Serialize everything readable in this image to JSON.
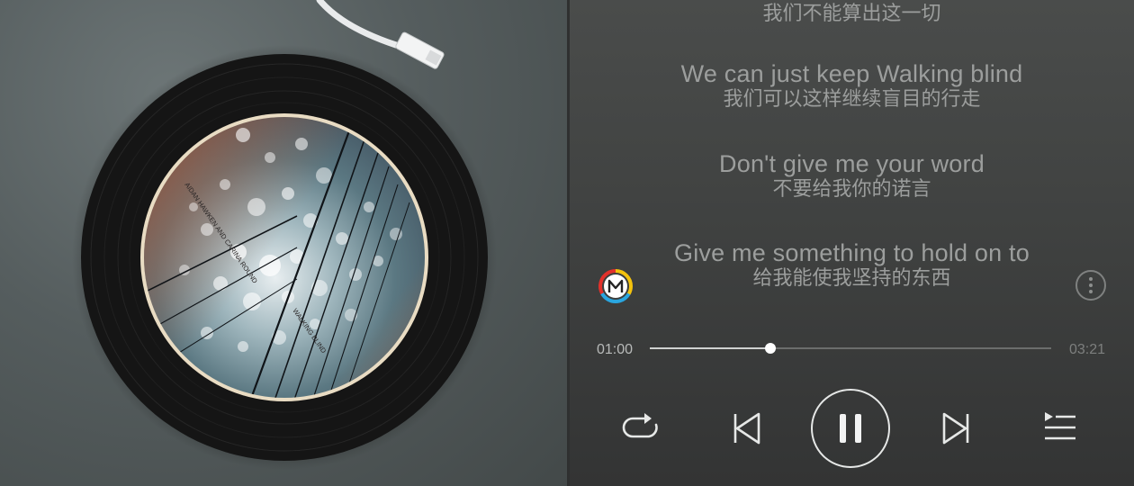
{
  "album": {
    "cover_text_1": "AIDAN HAWKEN AND CARINA ROUND",
    "cover_text_2": "WALKING BLIND"
  },
  "lyrics": [
    {
      "en": "",
      "zh": "我们不能算出这一切"
    },
    {
      "en": "We can just keep Walking blind",
      "zh": "我们可以这样继续盲目的行走"
    },
    {
      "en": "Don't give me your word",
      "zh": "不要给我你的诺言"
    },
    {
      "en": "Give me something to hold on to",
      "zh": "给我能使我坚持的东西"
    }
  ],
  "player": {
    "current_time": "01:00",
    "total_time": "03:21",
    "progress": 0.3,
    "logo_icon": "app-logo-m-icon",
    "more_icon": "more-vertical-icon"
  },
  "controls": {
    "repeat_icon": "repeat-icon",
    "prev_icon": "skip-previous-icon",
    "pause_icon": "pause-icon",
    "next_icon": "skip-next-icon",
    "playlist_icon": "playlist-icon"
  },
  "colors": {
    "text_dim": "#9c9e9d",
    "control": "#e6e8e7",
    "logo_red": "#e2312b",
    "logo_yellow": "#f4c20d",
    "logo_blue": "#2aa6e0"
  }
}
